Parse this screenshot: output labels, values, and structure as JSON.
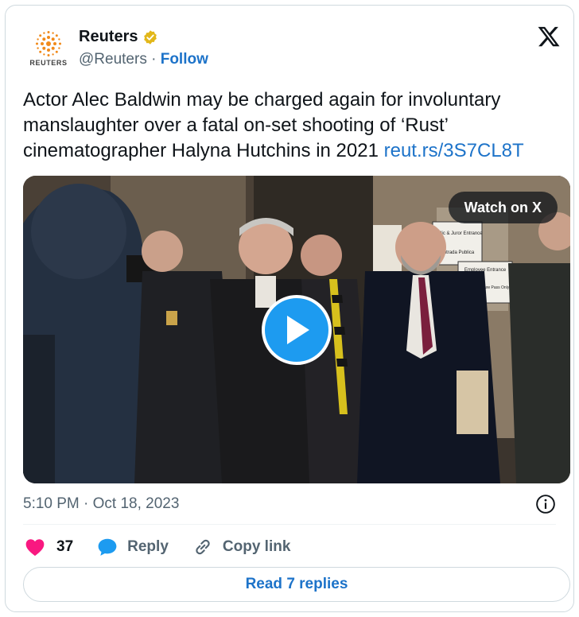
{
  "account": {
    "display_name": "Reuters",
    "handle": "@Reuters",
    "separator": " · ",
    "follow_label": "Follow",
    "avatar_wordmark": "REUTERS"
  },
  "tweet": {
    "text": "Actor Alec Baldwin may be charged again for involuntary manslaughter over a fatal on-set shooting of ‘Rust’ cinematographer Halyna Hutchins in 2021 ",
    "link_text": "reut.rs/3S7CL8T",
    "timestamp": "5:10 PM · Oct 18, 2023"
  },
  "media": {
    "watch_label": "Watch on X",
    "signs": [
      "Public & Juror Entrance",
      "Entrada Publica",
      "Employee Entrance",
      "Cards or Secure Pass Only"
    ]
  },
  "actions": {
    "like_count": "37",
    "reply_label": "Reply",
    "copy_label": "Copy link",
    "read_replies_label": "Read 7 replies"
  },
  "colors": {
    "accent_link": "#1d73c9",
    "like": "#f91880",
    "play": "#1d9bf0",
    "verified": "#e2b719"
  },
  "icons": [
    "reuters-logo-icon",
    "verified-badge-icon",
    "x-logo-icon",
    "play-icon",
    "info-icon",
    "heart-icon",
    "reply-bubble-icon",
    "link-icon"
  ]
}
